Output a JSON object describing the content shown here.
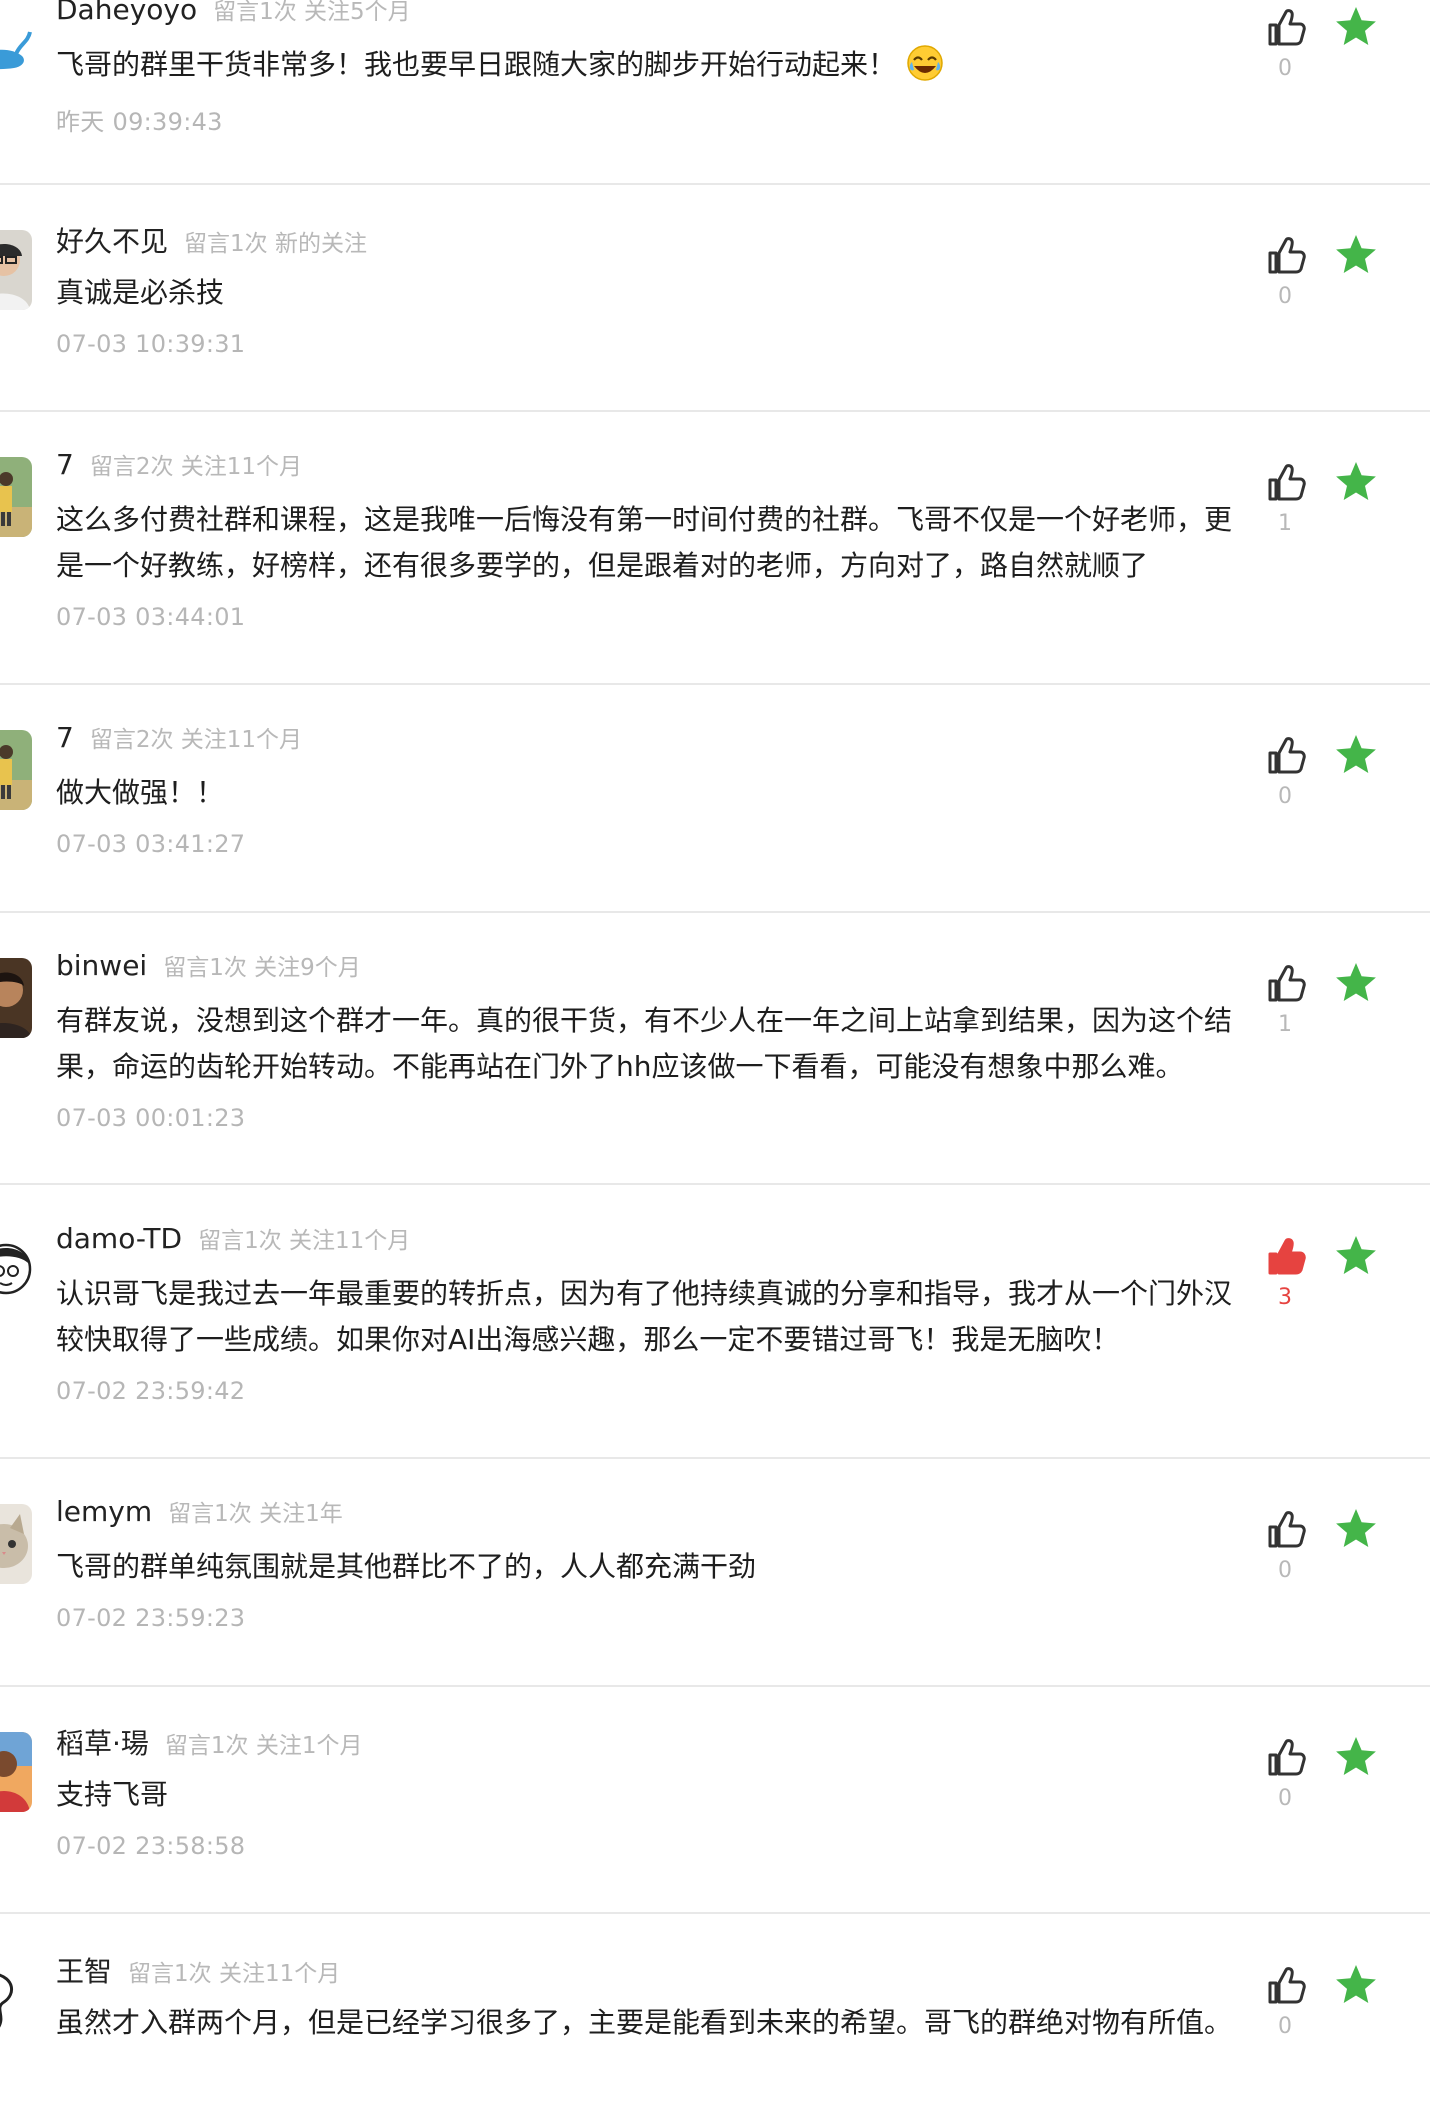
{
  "colors": {
    "star": "#44b549",
    "like_active": "#e64340",
    "like_inactive": "#333333"
  },
  "comments": [
    {
      "username": "Daheyoyo",
      "meta": "留言1次 关注5个月",
      "content": "飞哥的群里干货非常多！我也要早日跟随大家的脚步开始行动起来！",
      "emoji": "laughing-tears-emoji",
      "time": "昨天 09:39:43",
      "likes": "0",
      "liked": false,
      "avatar": "whale"
    },
    {
      "username": "好久不见",
      "meta": "留言1次 新的关注",
      "content": "真诚是必杀技",
      "time": "07-03 10:39:31",
      "likes": "0",
      "liked": false,
      "avatar": "person-glasses"
    },
    {
      "username": "7",
      "meta": "留言2次 关注11个月",
      "content": "这么多付费社群和课程，这是我唯一后悔没有第一时间付费的社群。飞哥不仅是一个好老师，更是一个好教练，好榜样，还有很多要学的，但是跟着对的老师，方向对了，路自然就顺了",
      "time": "07-03 03:44:01",
      "likes": "1",
      "liked": false,
      "avatar": "person-outdoor"
    },
    {
      "username": "7",
      "meta": "留言2次 关注11个月",
      "content": "做大做强！！",
      "time": "07-03 03:41:27",
      "likes": "0",
      "liked": false,
      "avatar": "person-outdoor"
    },
    {
      "username": "binwei",
      "meta": "留言1次 关注9个月",
      "content": "有群友说，没想到这个群才一年。真的很干货，有不少人在一年之间上站拿到结果，因为这个结果，命运的齿轮开始转动。不能再站在门外了hh应该做一下看看，可能没有想象中那么难。",
      "time": "07-03 00:01:23",
      "likes": "1",
      "liked": false,
      "avatar": "person-dark"
    },
    {
      "username": "damo-TD",
      "meta": "留言1次 关注11个月",
      "content": "认识哥飞是我过去一年最重要的转折点，因为有了他持续真诚的分享和指导，我才从一个门外汉较快取得了一些成绩。如果你对AI出海感兴趣，那么一定不要错过哥飞！我是无脑吹！",
      "time": "07-02 23:59:42",
      "likes": "3",
      "liked": true,
      "avatar": "cartoon-face"
    },
    {
      "username": "lemym",
      "meta": "留言1次 关注1年",
      "content": "飞哥的群单纯氛围就是其他群比不了的，人人都充满干劲",
      "time": "07-02 23:59:23",
      "likes": "0",
      "liked": false,
      "avatar": "cat"
    },
    {
      "username": "稻草·瑒",
      "meta": "留言1次 关注1个月",
      "content": "支持飞哥",
      "time": "07-02 23:58:58",
      "likes": "0",
      "liked": false,
      "avatar": "person-sunset"
    },
    {
      "username": "王智",
      "meta": "留言1次 关注11个月",
      "content": "虽然才入群两个月，但是已经学习很多了，主要是能看到未来的希望。哥飞的群绝对物有所值。",
      "time": "",
      "likes": "0",
      "liked": false,
      "avatar": "sketch"
    }
  ]
}
